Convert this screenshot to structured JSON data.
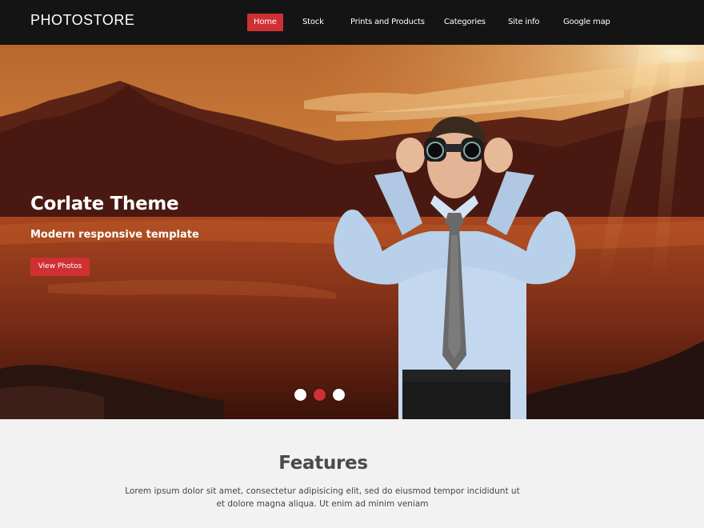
{
  "header": {
    "logo": "PHOTOSTORE",
    "nav": [
      {
        "label": "Home",
        "active": true
      },
      {
        "label": "Stock",
        "active": false
      },
      {
        "label": "Prints and Products",
        "active": false
      },
      {
        "label": "Categories",
        "active": false
      },
      {
        "label": "Site info",
        "active": false
      },
      {
        "label": "Google map",
        "active": false
      }
    ]
  },
  "hero": {
    "title": "Corlate Theme",
    "subtitle": "Modern responsive template",
    "button_label": "View Photos",
    "slides": 3,
    "active_slide": 2
  },
  "features": {
    "title": "Features",
    "text_line1": "Lorem ipsum dolor sit amet, consectetur adipisicing elit, sed do eiusmod tempor incididunt ut",
    "text_line2": "et dolore magna aliqua. Ut enim ad minim veniam"
  },
  "colors": {
    "accent": "#cf3034",
    "header_bg": "#141414",
    "section_bg": "#f2f2f2"
  }
}
